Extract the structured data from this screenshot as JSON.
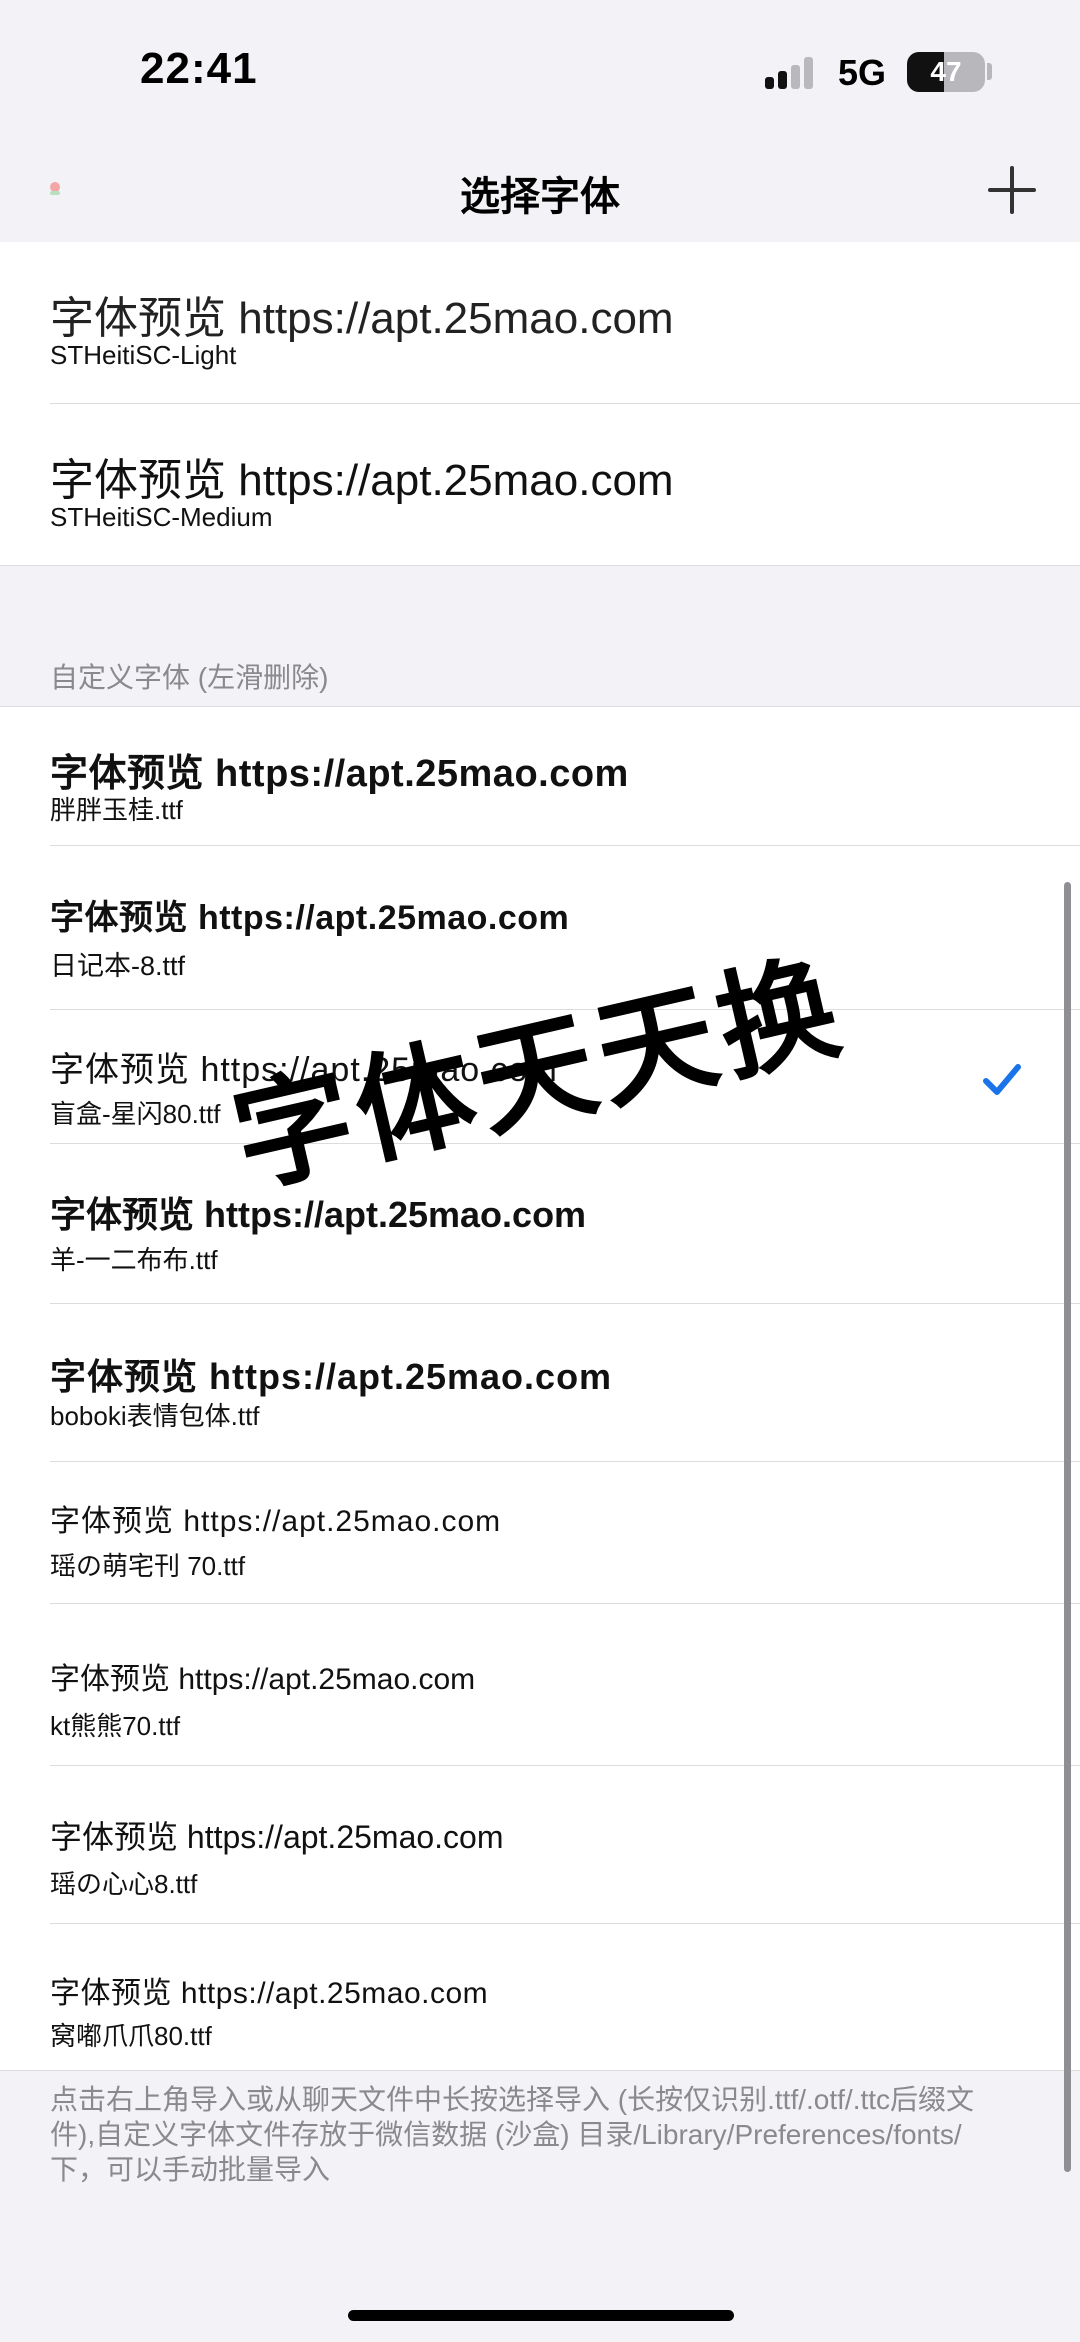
{
  "status_bar": {
    "time": "22:41",
    "network": "5G",
    "battery": "47",
    "battery_level": 0.47
  },
  "nav": {
    "title": "选择字体"
  },
  "system_fonts": [
    {
      "preview": "字体预览 https://apt.25mao.com",
      "name": "STHeitiSC-Light"
    },
    {
      "preview": "字体预览 https://apt.25mao.com",
      "name": "STHeitiSC-Medium"
    }
  ],
  "custom_section": {
    "header": "自定义字体 (左滑删除)"
  },
  "custom_fonts": [
    {
      "preview": "字体预览 https://apt.25mao.com",
      "name": "胖胖玉桂.ttf",
      "selected": false
    },
    {
      "preview": "字体预览 https://apt.25mao.com",
      "name": "日记本-8.ttf",
      "selected": false
    },
    {
      "preview": "字体预览 https://apt.25mao.com",
      "name": "盲盒-星闪80.ttf",
      "selected": true
    },
    {
      "preview": "字体预览 https://apt.25mao.com",
      "name": "羊-一二布布.ttf",
      "selected": false
    },
    {
      "preview": "字体预览 https://apt.25mao.com",
      "name": "boboki表情包体.ttf",
      "selected": false
    },
    {
      "preview": "字体预览 https://apt.25mao.com",
      "name": "瑶の萌宅刊 70.ttf",
      "selected": false
    },
    {
      "preview": "字体预览 https://apt.25mao.com",
      "name": "kt熊熊70.ttf",
      "selected": false
    },
    {
      "preview": "字体预览 https://apt.25mao.com",
      "name": "瑶の心心8.ttf",
      "selected": false
    },
    {
      "preview": "字体预览 https://apt.25mao.com",
      "name": "窝嘟爪爪80.ttf",
      "selected": false
    }
  ],
  "footer_note": "点击右上角导入或从聊天文件中长按选择导入 (长按仅识别.ttf/.otf/.ttc后缀文件),自定义字体文件存放于微信数据 (沙盒) 目录/Library/Preferences/fonts/下，可以手动批量导入",
  "watermark": "字体天天换",
  "colors": {
    "accent": "#1a73e8",
    "background": "#f2f2f7",
    "secondary_text": "#8a8a8e"
  }
}
